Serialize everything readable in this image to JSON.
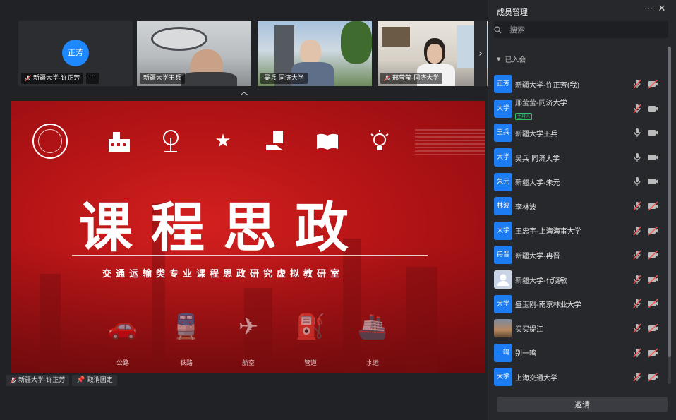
{
  "participants_strip": [
    {
      "name": "新疆大学-许正芳",
      "avatar_text": "正芳",
      "video": false
    },
    {
      "name": "新疆大学王兵",
      "video": true,
      "active": true
    },
    {
      "name": "吴兵 同济大学",
      "video": true
    },
    {
      "name": "邢莹莹-同济大学",
      "video": true
    }
  ],
  "slide": {
    "title": "课程思政",
    "subtitle": "交通运输类专业课程思政研究虚拟教研室",
    "transport_labels": [
      "公路",
      "铁路",
      "航空",
      "管道",
      "水运"
    ]
  },
  "pin_bar": {
    "speaker": "新疆大学-许正芳",
    "unpin_label": "取消固定"
  },
  "panel": {
    "title": "成员管理",
    "search_placeholder": "搜索",
    "joined_label": "已入会",
    "invite_label": "邀请",
    "members": [
      {
        "avatar": "正芳",
        "name": "新疆大学-许正芳(我)",
        "mic": "muted",
        "cam": "off"
      },
      {
        "avatar": "大学",
        "name": "邢莹莹-同济大学",
        "badge": "主持人",
        "mic": "muted",
        "cam": "on"
      },
      {
        "avatar": "王兵",
        "name": "新疆大学王兵",
        "mic": "on",
        "cam": "on"
      },
      {
        "avatar": "大学",
        "name": "吴兵 同济大学",
        "mic": "on",
        "cam": "on"
      },
      {
        "avatar": "朱元",
        "name": "新疆大学-朱元",
        "mic": "on",
        "cam": "on"
      },
      {
        "avatar": "林波",
        "name": "李林波",
        "mic": "muted",
        "cam": "off"
      },
      {
        "avatar": "大学",
        "name": "王忠宇-上海海事大学",
        "mic": "muted",
        "cam": "off"
      },
      {
        "avatar": "冉晋",
        "name": "新疆大学-冉晋",
        "mic": "muted",
        "cam": "off"
      },
      {
        "avatar": "",
        "avatar_type": "person",
        "name": "新疆大学-代晓敏",
        "mic": "muted",
        "cam": "off"
      },
      {
        "avatar": "大学",
        "name": "盛玉刚-南京林业大学",
        "mic": "muted",
        "cam": "off"
      },
      {
        "avatar": "",
        "avatar_type": "photo",
        "name": "买买提江",
        "mic": "muted",
        "cam": "off"
      },
      {
        "avatar": "一鸣",
        "name": "别一鸣",
        "mic": "muted",
        "cam": "off"
      },
      {
        "avatar": "大学",
        "name": "上海交通大学",
        "mic": "muted",
        "cam": "off"
      }
    ]
  },
  "colors": {
    "accent": "#1e7cf2",
    "active_border": "#2db55d",
    "host_badge": "#2fc26a",
    "slide_red": "#c4191b"
  }
}
